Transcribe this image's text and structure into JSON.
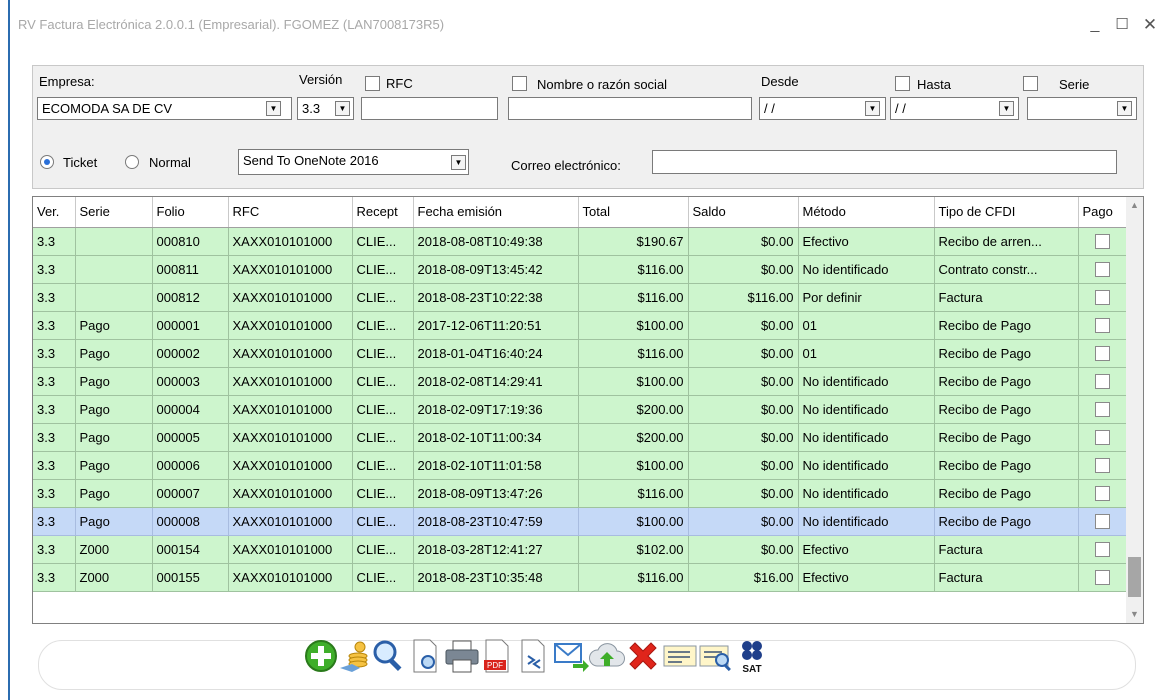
{
  "window": {
    "title": "RV Factura Electrónica 2.0.0.1 (Empresarial). FGOMEZ (LAN7008173R5)",
    "minimize": "_",
    "maximize": "☐",
    "close": "✕"
  },
  "filters": {
    "empresa_label": "Empresa:",
    "empresa_value": "ECOMODA SA DE CV",
    "version_label": "Versión",
    "version_value": "3.3",
    "rfc_label": "RFC",
    "rfc_value": "",
    "nombre_label": "Nombre o razón social",
    "nombre_value": "",
    "desde_label": "Desde",
    "desde_value": " / /",
    "hasta_label": "Hasta",
    "hasta_value": " / /",
    "serie_label": "Serie",
    "serie_value": "",
    "ticket_label": "Ticket",
    "normal_label": "Normal",
    "printer_value": "Send To OneNote 2016",
    "correo_label": "Correo electrónico:",
    "correo_value": ""
  },
  "grid": {
    "columns": [
      "Ver.",
      "Serie",
      "Folio",
      "RFC",
      "Recept",
      "Fecha emisión",
      "Total",
      "Saldo",
      "Método",
      "Tipo de CFDI",
      "Pago"
    ],
    "rows": [
      [
        "3.3",
        "",
        "000810",
        "XAXX010101000",
        "CLIE...",
        "2018-08-08T10:49:38",
        "$190.67",
        "$0.00",
        "Efectivo",
        "Recibo de arren..."
      ],
      [
        "3.3",
        "",
        "000811",
        "XAXX010101000",
        "CLIE...",
        "2018-08-09T13:45:42",
        "$116.00",
        "$0.00",
        "No identificado",
        "Contrato constr..."
      ],
      [
        "3.3",
        "",
        "000812",
        "XAXX010101000",
        "CLIE...",
        "2018-08-23T10:22:38",
        "$116.00",
        "$116.00",
        "Por definir",
        "Factura"
      ],
      [
        "3.3",
        "Pago",
        "000001",
        "XAXX010101000",
        "CLIE...",
        "2017-12-06T11:20:51",
        "$100.00",
        "$0.00",
        "01",
        "Recibo de Pago"
      ],
      [
        "3.3",
        "Pago",
        "000002",
        "XAXX010101000",
        "CLIE...",
        "2018-01-04T16:40:24",
        "$116.00",
        "$0.00",
        "01",
        "Recibo de Pago"
      ],
      [
        "3.3",
        "Pago",
        "000003",
        "XAXX010101000",
        "CLIE...",
        "2018-02-08T14:29:41",
        "$100.00",
        "$0.00",
        "No identificado",
        "Recibo de Pago"
      ],
      [
        "3.3",
        "Pago",
        "000004",
        "XAXX010101000",
        "CLIE...",
        "2018-02-09T17:19:36",
        "$200.00",
        "$0.00",
        "No identificado",
        "Recibo de Pago"
      ],
      [
        "3.3",
        "Pago",
        "000005",
        "XAXX010101000",
        "CLIE...",
        "2018-02-10T11:00:34",
        "$200.00",
        "$0.00",
        "No identificado",
        "Recibo de Pago"
      ],
      [
        "3.3",
        "Pago",
        "000006",
        "XAXX010101000",
        "CLIE...",
        "2018-02-10T11:01:58",
        "$100.00",
        "$0.00",
        "No identificado",
        "Recibo de Pago"
      ],
      [
        "3.3",
        "Pago",
        "000007",
        "XAXX010101000",
        "CLIE...",
        "2018-08-09T13:47:26",
        "$116.00",
        "$0.00",
        "No identificado",
        "Recibo de Pago"
      ],
      [
        "3.3",
        "Pago",
        "000008",
        "XAXX010101000",
        "CLIE...",
        "2018-08-23T10:47:59",
        "$100.00",
        "$0.00",
        "No identificado",
        "Recibo de Pago"
      ],
      [
        "3.3",
        "Z000",
        "000154",
        "XAXX010101000",
        "CLIE...",
        "2018-03-28T12:41:27",
        "$102.00",
        "$0.00",
        "Efectivo",
        "Factura"
      ],
      [
        "3.3",
        "Z000",
        "000155",
        "XAXX010101000",
        "CLIE...",
        "2018-08-23T10:35:48",
        "$116.00",
        "$16.00",
        "Efectivo",
        "Factura"
      ]
    ],
    "selected_row": 10
  },
  "toolbar": {
    "pdf_text": "PDF",
    "sat_text": "SAT"
  },
  "colors": {
    "row_bg": "#cdf5cd",
    "selected_bg": "#c5d9f7",
    "accent": "#2b6cb0"
  }
}
